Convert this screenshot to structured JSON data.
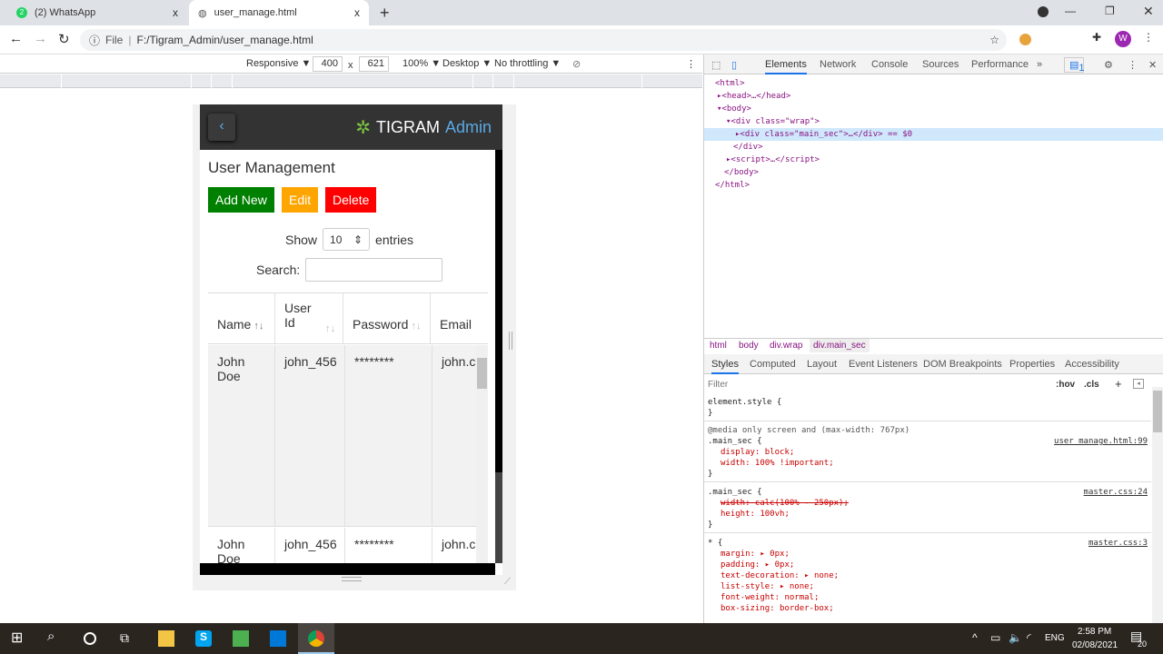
{
  "browser": {
    "tabs": [
      {
        "label": "(2) WhatsApp",
        "badge": "2"
      },
      {
        "label": "user_manage.html"
      }
    ],
    "new_tab": "+",
    "close": "x",
    "address_prefix": "File",
    "url": "F:/Tigram_Admin/user_manage.html",
    "profile": "W"
  },
  "device_toolbar": {
    "mode": "Responsive ▼",
    "width": "400",
    "x": "x",
    "height": "621",
    "zoom": "100% ▼",
    "type": "Desktop ▼",
    "throttle": "No throttling ▼"
  },
  "page": {
    "brand": "TIGRAM",
    "brand_suffix": "Admin",
    "back": "‹",
    "title": "User Management",
    "buttons": {
      "add": "Add New",
      "edit": "Edit",
      "delete": "Delete"
    },
    "show_label": "Show",
    "entries_value": "10",
    "entries_label": "entries",
    "search_label": "Search:",
    "columns": [
      "Name",
      "User Id",
      "Password",
      "Email"
    ],
    "rows": [
      {
        "name": "John Doe",
        "userid": "john_456",
        "password": "********",
        "email": "john.c"
      },
      {
        "name": "John Doe",
        "userid": "john_456",
        "password": "********",
        "email": "john.c"
      }
    ],
    "colors": {
      "add": "#008000",
      "edit": "#ffa500",
      "delete": "#ff0000",
      "header": "#333333"
    }
  },
  "devtools": {
    "tabs": [
      "Elements",
      "Network",
      "Console",
      "Sources",
      "Performance",
      "»"
    ],
    "issues": "1",
    "dom": [
      "<html>",
      "<head>…</head>",
      "<body>",
      "<div class=\"wrap\">",
      "<div class=\"main_sec\">…</div> == $0",
      "</div>",
      "<script>…</script>",
      "</body>",
      "</html>"
    ],
    "crumbs": [
      "html",
      "body",
      "div.wrap",
      "div.main_sec"
    ],
    "style_tabs": [
      "Styles",
      "Computed",
      "Layout",
      "Event Listeners",
      "DOM Breakpoints",
      "Properties",
      "Accessibility"
    ],
    "filter": "Filter",
    "hov": ":hov",
    "cls": ".cls",
    "rules": [
      {
        "selector": "element.style {",
        "props": [],
        "src": ""
      },
      {
        "media": "@media only screen and (max-width: 767px)",
        "selector": ".main_sec {",
        "props": [
          "display: block;",
          "width: 100% !important;"
        ],
        "src": "user_manage.html:99"
      },
      {
        "selector": ".main_sec {",
        "props": [
          "width: calc(100% - 250px);",
          "height: 100vh;"
        ],
        "src": "master.css:24"
      },
      {
        "selector": "* {",
        "props": [
          "margin: ▸ 0px;",
          "padding: ▸ 0px;",
          "text-decoration: ▸ none;",
          "list-style: ▸ none;",
          "font-weight: normal;",
          "box-sizing: border-box;"
        ],
        "src": "master.css:3"
      }
    ]
  },
  "taskbar": {
    "lang": "ENG",
    "time": "2:58 PM",
    "date": "02/08/2021",
    "notifications": "20"
  }
}
